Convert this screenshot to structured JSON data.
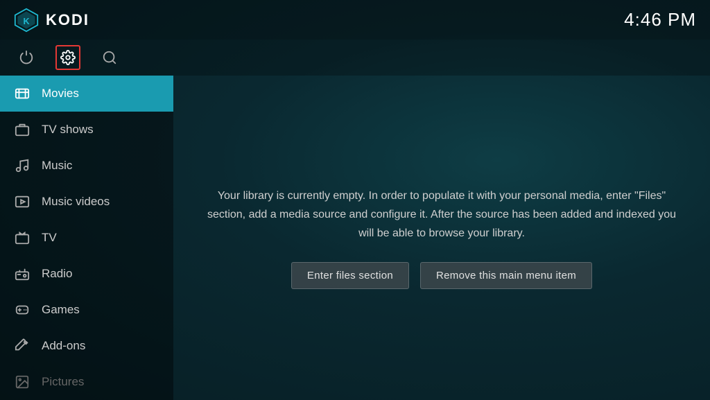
{
  "app": {
    "name": "KODI",
    "time": "4:46 PM"
  },
  "iconbar": {
    "power_label": "power",
    "settings_label": "settings",
    "search_label": "search"
  },
  "sidebar": {
    "items": [
      {
        "id": "movies",
        "label": "Movies",
        "icon": "🎬",
        "active": true
      },
      {
        "id": "tv-shows",
        "label": "TV shows",
        "icon": "📺",
        "active": false
      },
      {
        "id": "music",
        "label": "Music",
        "icon": "🎧",
        "active": false
      },
      {
        "id": "music-videos",
        "label": "Music videos",
        "icon": "🎞",
        "active": false
      },
      {
        "id": "tv",
        "label": "TV",
        "icon": "📡",
        "active": false
      },
      {
        "id": "radio",
        "label": "Radio",
        "icon": "📻",
        "active": false
      },
      {
        "id": "games",
        "label": "Games",
        "icon": "🎮",
        "active": false
      },
      {
        "id": "add-ons",
        "label": "Add-ons",
        "icon": "🧩",
        "active": false
      },
      {
        "id": "pictures",
        "label": "Pictures",
        "icon": "🖼",
        "active": false,
        "dimmed": true
      }
    ]
  },
  "main": {
    "empty_message": "Your library is currently empty. In order to populate it with your personal media, enter \"Files\" section, add a media source and configure it. After the source has been added and indexed you will be able to browse your library.",
    "btn_enter_files": "Enter files section",
    "btn_remove_item": "Remove this main menu item"
  }
}
